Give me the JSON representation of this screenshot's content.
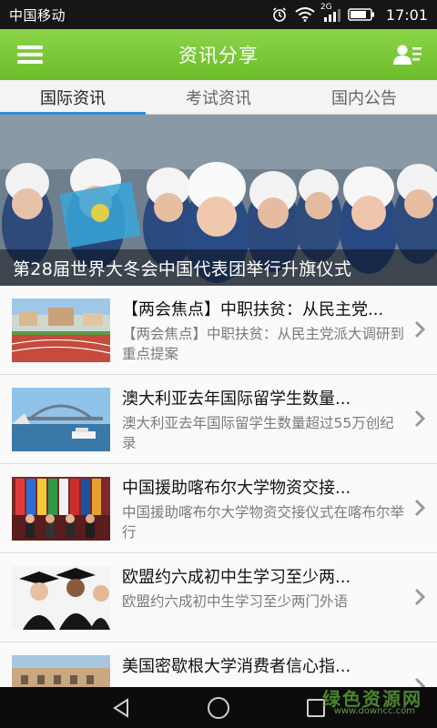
{
  "status_bar": {
    "carrier": "中国移动",
    "network": "2G",
    "time": "17:01"
  },
  "header": {
    "title": "资讯分享"
  },
  "tabs": [
    {
      "label": "国际资讯",
      "active": true
    },
    {
      "label": "考试资讯",
      "active": false
    },
    {
      "label": "国内公告",
      "active": false
    }
  ],
  "banner": {
    "caption": "第28届世界大冬会中国代表团举行升旗仪式"
  },
  "news": [
    {
      "title": "【两会焦点】中职扶贫：从民主党...",
      "summary": "【两会焦点】中职扶贫：从民主党派大调研到重点提案",
      "thumb": "campus-track-photo"
    },
    {
      "title": "澳大利亚去年国际留学生数量...",
      "summary": "澳大利亚去年国际留学生数量超过55万创纪录",
      "thumb": "harbour-bridge-photo"
    },
    {
      "title": "中国援助喀布尔大学物资交接...",
      "summary": "中国援助喀布尔大学物资交接仪式在喀布尔举行",
      "thumb": "flags-ceremony-photo"
    },
    {
      "title": "欧盟约六成初中生学习至少两...",
      "summary": "欧盟约六成初中生学习至少两门外语",
      "thumb": "graduates-photo"
    },
    {
      "title": "美国密歇根大学消费者信心指...",
      "summary": "",
      "thumb": "building-photo"
    }
  ],
  "watermark": {
    "text": "绿色资源网",
    "url": "www.downcc.com"
  },
  "colors": {
    "header_green": "#7cc83a",
    "tab_indicator": "#2a8fd6"
  }
}
